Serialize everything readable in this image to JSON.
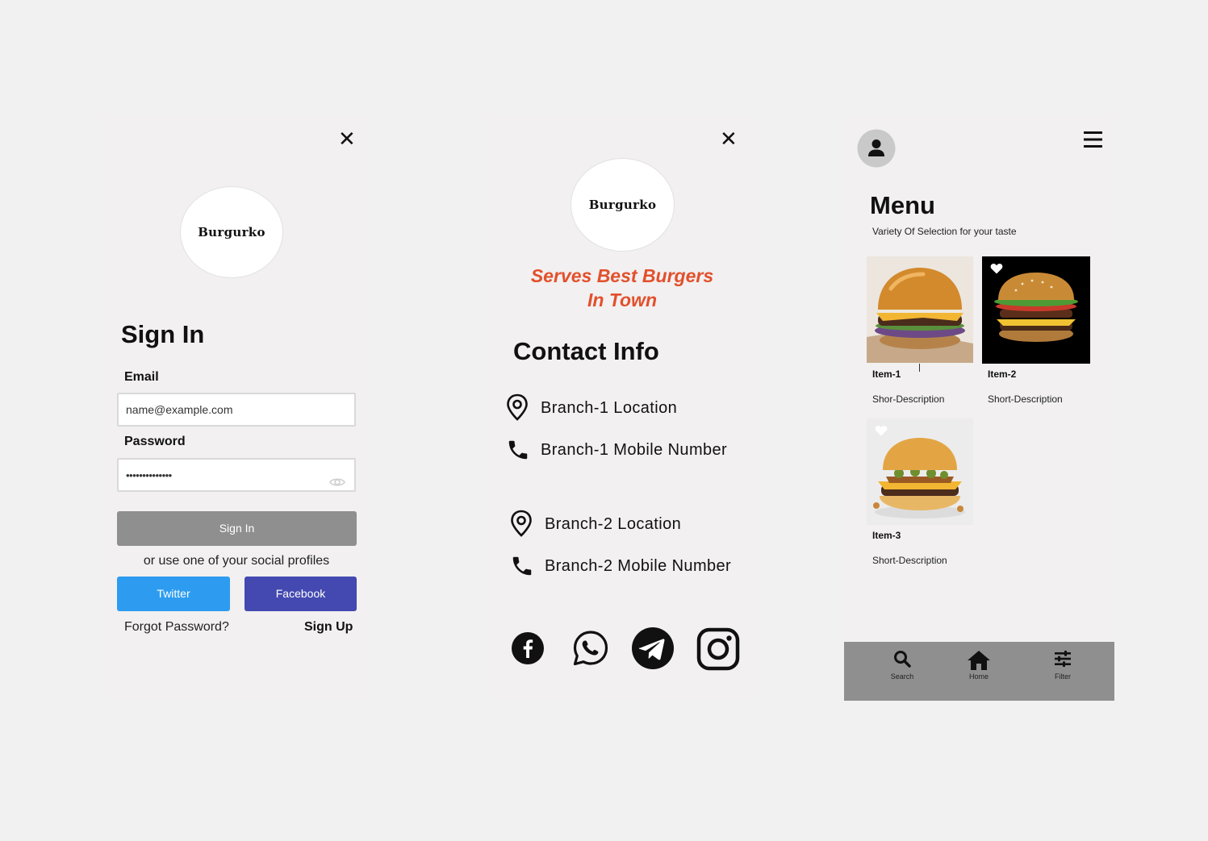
{
  "signin": {
    "logo_text": "Burgurko",
    "title": "Sign In",
    "email_label": "Email",
    "email_placeholder": "name@example.com",
    "password_label": "Password",
    "password_value": "••••••••••••••",
    "submit_label": "Sign In",
    "social_prompt": "or use one of your social profiles",
    "twitter_label": "Twitter",
    "facebook_label": "Facebook",
    "forgot_label": "Forgot Password?",
    "signup_label": "Sign Up"
  },
  "contact": {
    "logo_text": "Burgurko",
    "tagline_line1": "Serves Best Burgers",
    "tagline_line2": "In Town",
    "title": "Contact Info",
    "branches": [
      {
        "location": "Branch-1 Location",
        "mobile": "Branch-1 Mobile Number"
      },
      {
        "location": "Branch-2 Location",
        "mobile": "Branch-2 Mobile Number"
      }
    ],
    "social_icons": [
      "facebook-icon",
      "whatsapp-icon",
      "telegram-icon",
      "instagram-icon"
    ]
  },
  "menu": {
    "title": "Menu",
    "subtitle": "Variety Of Selection for your taste",
    "items": [
      {
        "name": "Item-1",
        "description": "Shor-Description"
      },
      {
        "name": "Item-2",
        "description": "Short-Description"
      },
      {
        "name": "Item-3",
        "description": "Short-Description"
      }
    ],
    "nav": [
      {
        "label": "Search",
        "icon": "search-icon"
      },
      {
        "label": "Home",
        "icon": "home-icon"
      },
      {
        "label": "Filter",
        "icon": "filter-icon"
      }
    ]
  },
  "colors": {
    "accent_red": "#e2502c",
    "twitter": "#2d9cf0",
    "facebook": "#4349b0",
    "signin_button": "#8f8f8f",
    "nav_bar": "#8f8f8f"
  }
}
